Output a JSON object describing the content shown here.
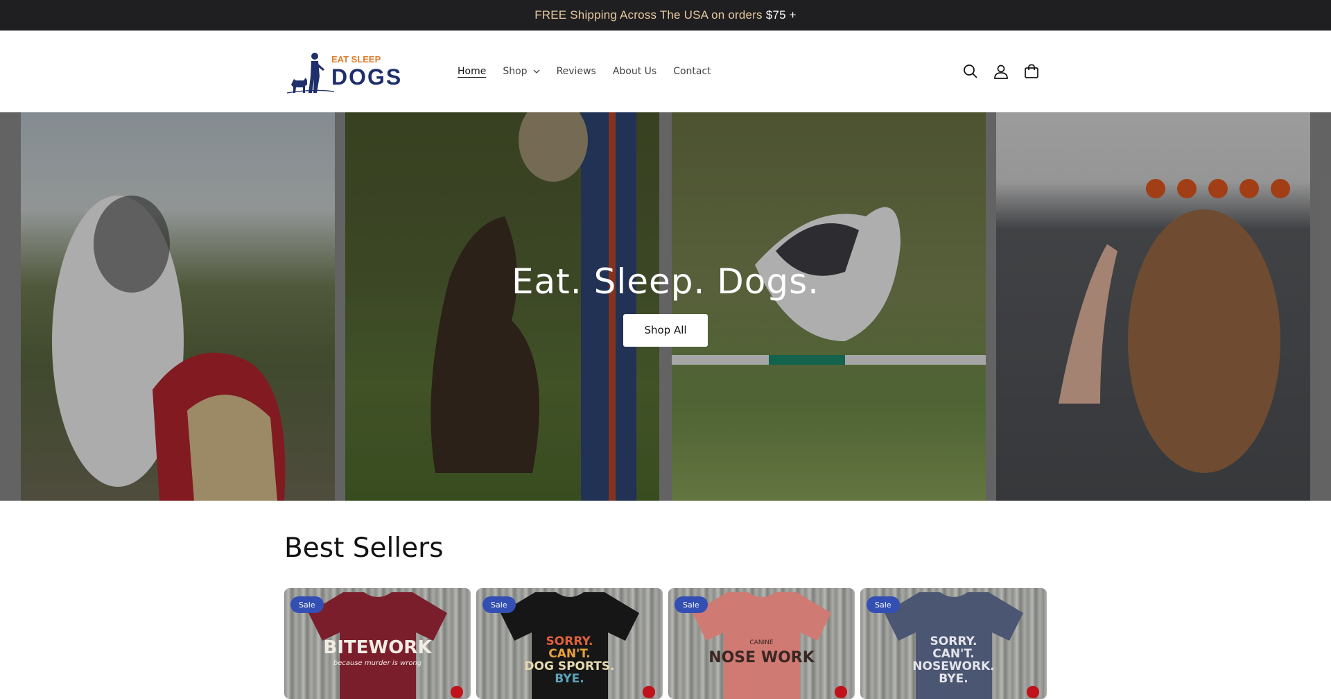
{
  "announcement": {
    "text": "FREE Shipping Across The USA on orders",
    "amount": "$75 +"
  },
  "header": {
    "logo_top": "EAT SLEEP",
    "logo_bottom": "DOGS",
    "nav": [
      {
        "label": "Home",
        "active": true
      },
      {
        "label": "Shop",
        "has_dropdown": true
      },
      {
        "label": "Reviews"
      },
      {
        "label": "About Us"
      },
      {
        "label": "Contact"
      }
    ],
    "icons": [
      "search-icon",
      "account-icon",
      "cart-icon"
    ]
  },
  "hero": {
    "title": "Eat. Sleep. Dogs.",
    "button_label": "Shop All"
  },
  "bestsellers": {
    "title": "Best Sellers",
    "products": [
      {
        "badge": "Sale",
        "shirt_color": "#7a1e2c",
        "text_lines": [
          "BITEWORK",
          "because murder is wrong"
        ],
        "text_color": "#f1ece4"
      },
      {
        "badge": "Sale",
        "shirt_color": "#161616",
        "text_lines": [
          "SORRY.",
          "CAN'T.",
          "DOG SPORTS.",
          "BYE."
        ],
        "text_color": "#e0803c"
      },
      {
        "badge": "Sale",
        "shirt_color": "#d07a74",
        "text_lines": [
          "CANINE",
          "NOSE WORK"
        ],
        "text_color": "#3a2722"
      },
      {
        "badge": "Sale",
        "shirt_color": "#4a5672",
        "text_lines": [
          "SORRY.",
          "CAN'T.",
          "NOSEWORK.",
          "BYE."
        ],
        "text_color": "#e4e4ea"
      }
    ]
  },
  "colors": {
    "announcement_bg": "#1f1f21",
    "accent_badge": "#334fb4",
    "logo_orange": "#e07b2a",
    "logo_navy": "#1f2f6b"
  }
}
